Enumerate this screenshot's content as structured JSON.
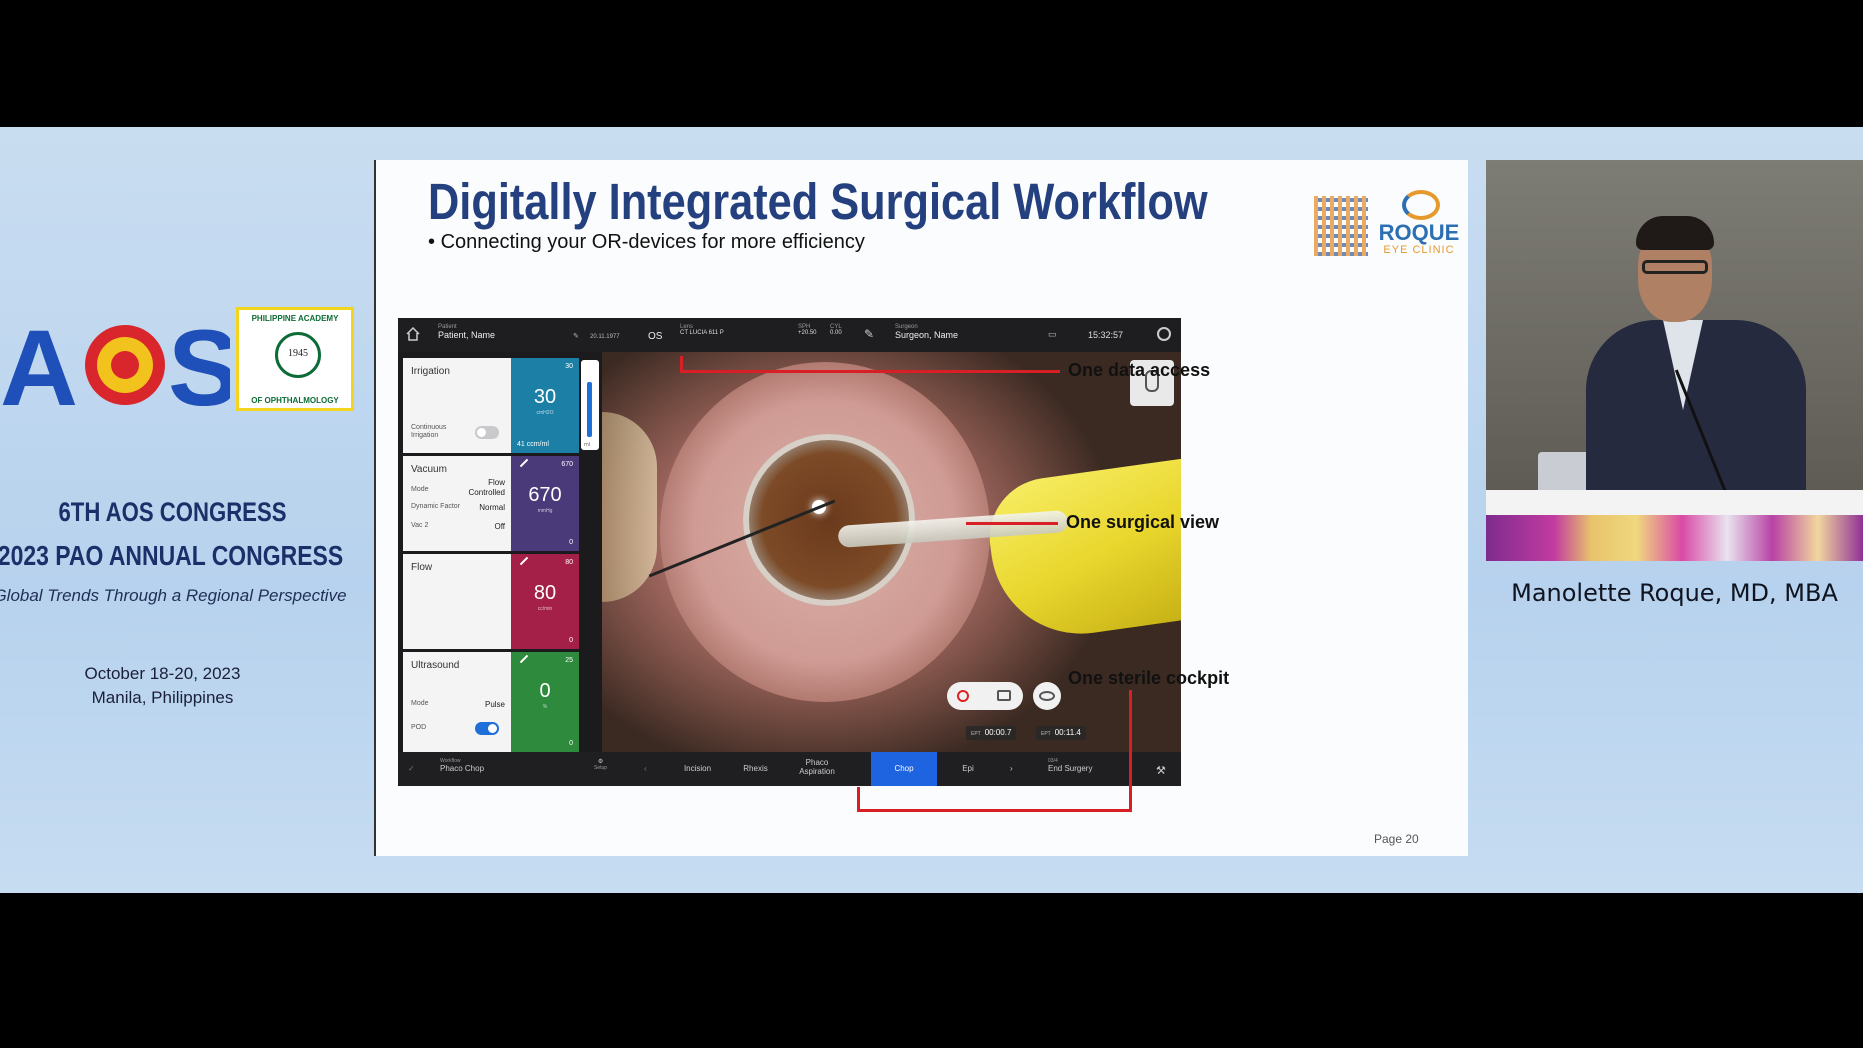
{
  "conference": {
    "aos_logo_text": "AOS",
    "pao_badge_top": "PHILIPPINE ACADEMY",
    "pao_badge_year": "1945",
    "pao_badge_bottom": "OF OPHTHALMOLOGY",
    "line1": "6TH AOS CONGRESS",
    "line2": "2023 PAO ANNUAL CONGRESS",
    "tagline": "Global Trends Through a Regional Perspective",
    "dates": "October 18-20, 2023",
    "location": "Manila, Philippines"
  },
  "slide": {
    "title": "Digitally Integrated Surgical Workflow",
    "bullet": "Connecting your OR-devices for more efficiency",
    "brand_name": "ROQUE",
    "brand_sub": "EYE CLINIC",
    "page": "Page 20",
    "callouts": [
      "One data access",
      "One surgical view",
      "One sterile cockpit"
    ]
  },
  "device": {
    "topbar": {
      "patient_label": "Patient",
      "patient_value": "Patient, Name",
      "dob": "20.11.1977",
      "eye": "OS",
      "lens_label": "Lens",
      "lens_value": "CT LUCIA 611 P",
      "sph_label": "SPH",
      "sph_value": "+20.50",
      "cyl_label": "CYL",
      "cyl_value": "0.00",
      "surgeon_label": "Surgeon",
      "surgeon_value": "Surgeon, Name",
      "time": "15:32:57"
    },
    "irrigation": {
      "name": "Irrigation",
      "max": "30",
      "value": "30",
      "unit": "cmH2O",
      "foot": "41 ccm/ml",
      "toggle_label": "Continuous Irrigation",
      "toggle_on": false,
      "color": "#1c7fa6"
    },
    "vacuum": {
      "name": "Vacuum",
      "mode_label": "Mode",
      "mode_value": "Flow Controlled",
      "dyn_label": "Dynamic Factor",
      "dyn_value": "Normal",
      "vac2_label": "Vac 2",
      "vac2_value": "Off",
      "max": "670",
      "value": "670",
      "unit": "mmHg",
      "min": "0",
      "color": "#4b3a7a"
    },
    "flow": {
      "name": "Flow",
      "max": "80",
      "value": "80",
      "unit": "cc/min",
      "min": "0",
      "color": "#a52048"
    },
    "ultrasound": {
      "name": "Ultrasound",
      "mode_label": "Mode",
      "mode_value": "Pulse",
      "pod_label": "POD",
      "pod_on": true,
      "max": "25",
      "value": "0",
      "unit": "%",
      "min": "0",
      "color": "#2e8a3d"
    },
    "bottle_unit": "ml",
    "timers": [
      {
        "label": "EPT",
        "value": "00:00.7"
      },
      {
        "label": "EPT",
        "value": "00:11.4"
      }
    ],
    "bottombar": {
      "workflow_label": "Workflow",
      "workflow_value": "Phaco Chop",
      "setup": "Setup",
      "steps": [
        "Incision",
        "Rhexis",
        "Phaco Aspiration",
        "Chop",
        "Epi"
      ],
      "active_step": "Chop",
      "end_label": "03/4",
      "end_value": "End Surgery"
    }
  },
  "presenter": {
    "name": "Manolette Roque, MD, MBA"
  }
}
